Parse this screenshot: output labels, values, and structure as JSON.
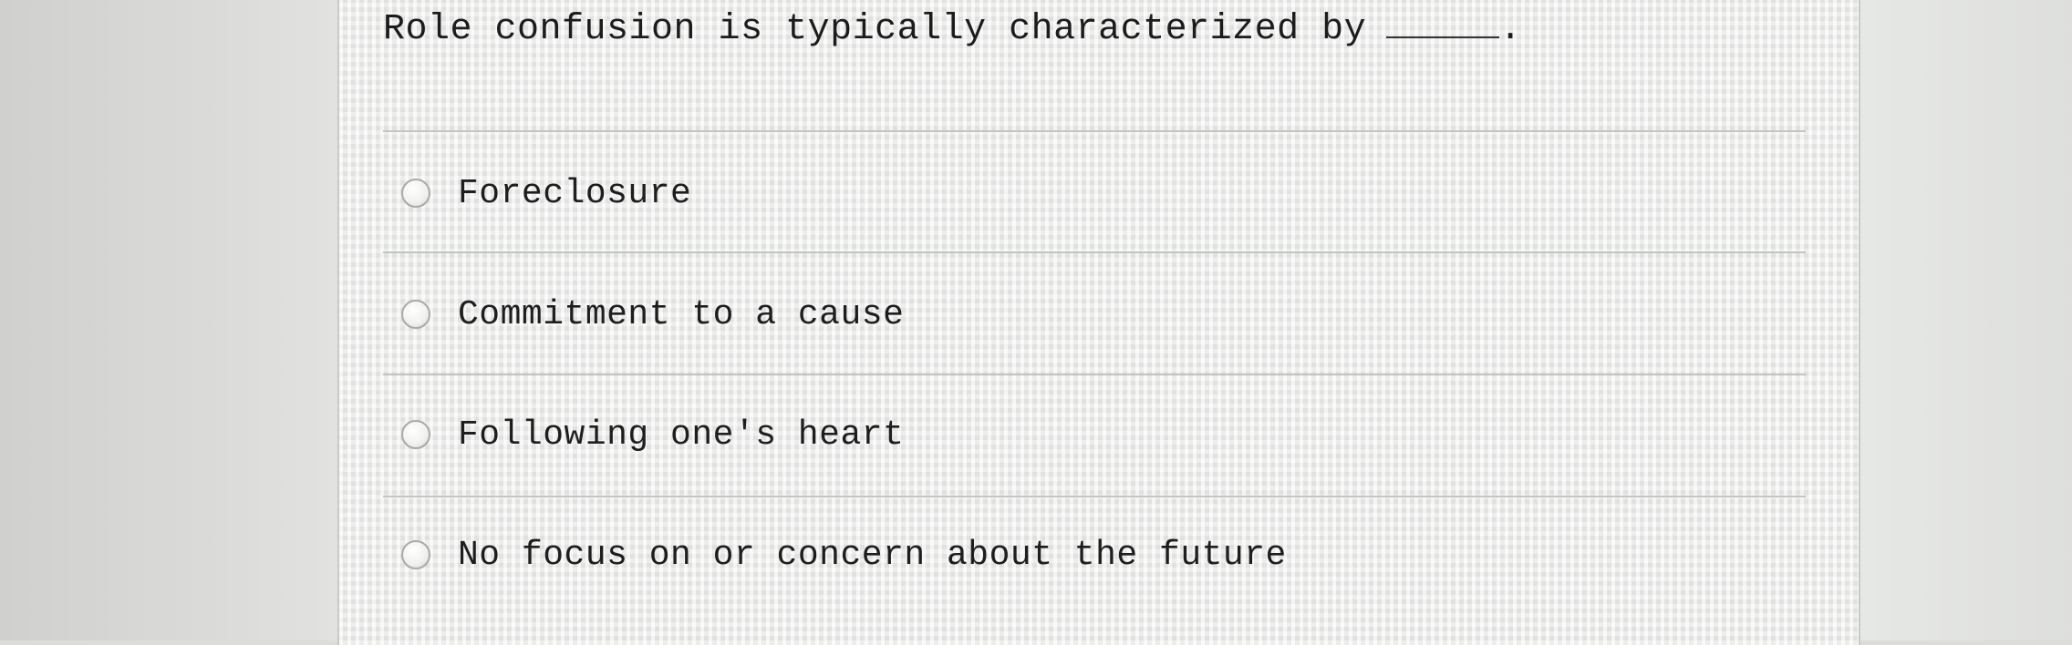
{
  "question": {
    "text": "Role confusion is typically characterized by",
    "terminal": "."
  },
  "options": [
    {
      "label": "Foreclosure",
      "selected": false
    },
    {
      "label": "Commitment to a cause",
      "selected": false
    },
    {
      "label": "Following one's heart",
      "selected": false
    },
    {
      "label": "No focus on or concern about the future",
      "selected": false
    }
  ]
}
